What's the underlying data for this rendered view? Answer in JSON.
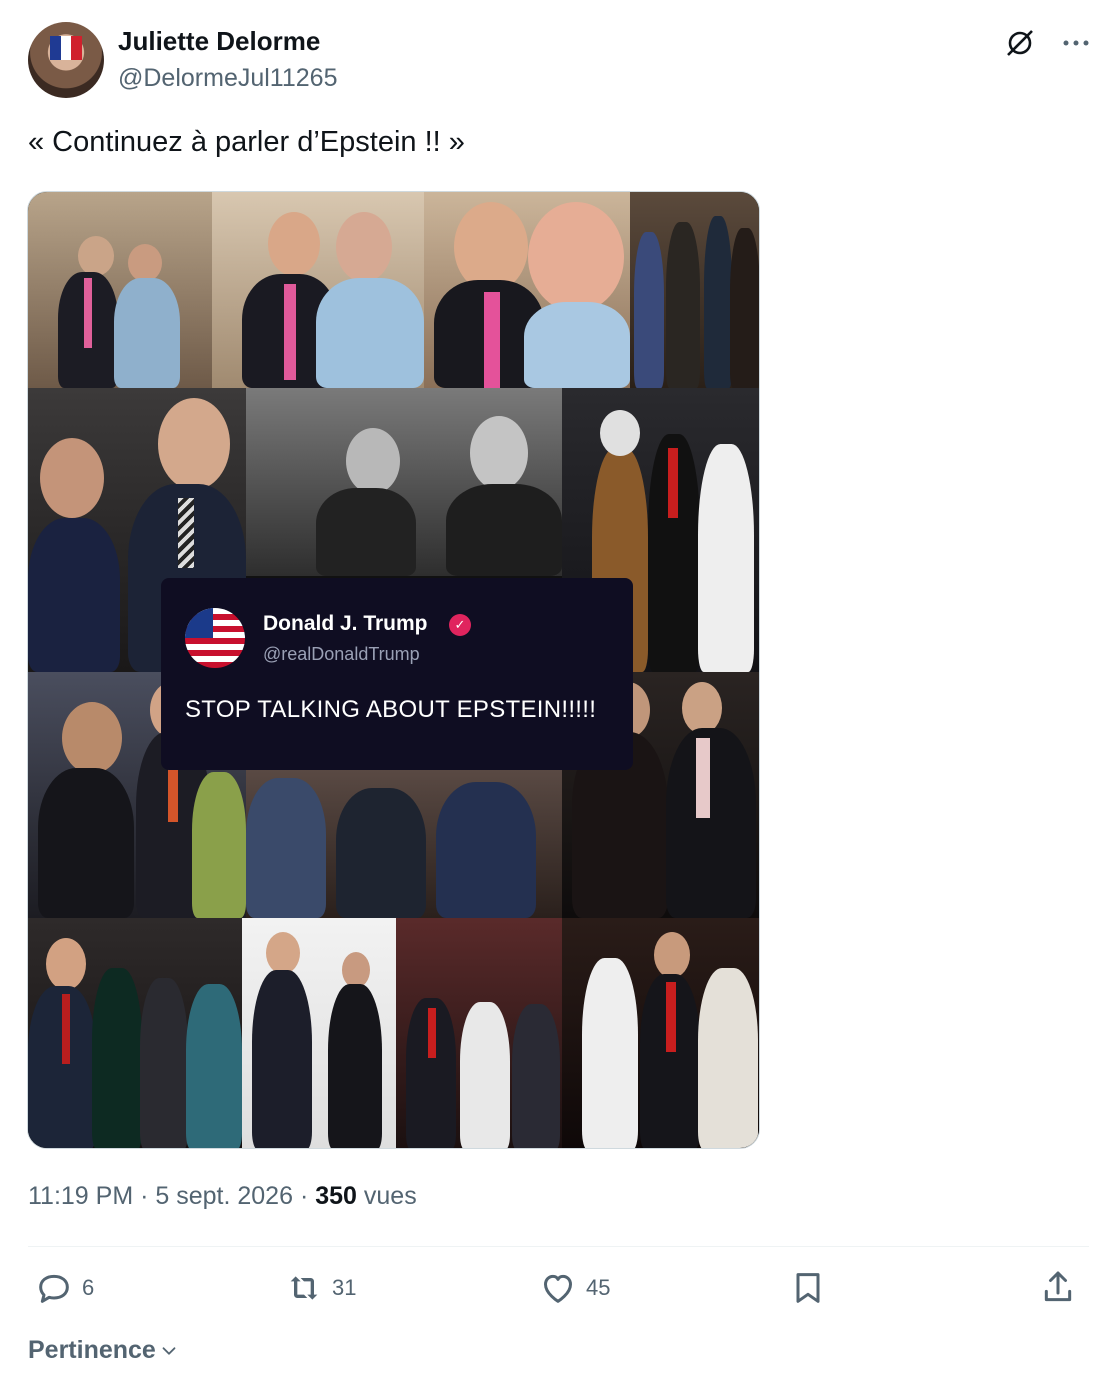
{
  "author": {
    "name": "Juliette Delorme",
    "handle": "@DelormeJul11265"
  },
  "header_icons": [
    "grok-icon",
    "more-icon"
  ],
  "tweet": {
    "text": "« Continuez à parler d’Epstein !! »"
  },
  "embedded_post": {
    "name": "Donald J. Trump",
    "handle": "@realDonaldTrump",
    "text": "STOP TALKING ABOUT EPSTEIN!!!!!"
  },
  "meta": {
    "time": "11:19 PM",
    "separator": " · ",
    "date": "5 sept. 2026",
    "views_count": "350",
    "views_label": "vues"
  },
  "actions": {
    "replies": "6",
    "reposts": "31",
    "likes": "45"
  },
  "sort": {
    "label": "Pertinence"
  },
  "colors": {
    "text_primary": "#0f1419",
    "text_secondary": "#536471",
    "divider": "#eff3f4",
    "verified_badge": "#e0245e"
  }
}
